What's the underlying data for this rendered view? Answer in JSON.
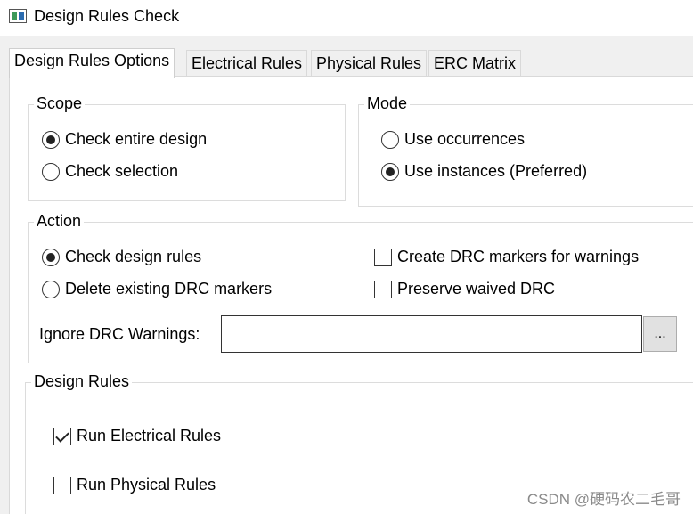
{
  "window": {
    "title": "Design Rules Check",
    "icon": "app-icon"
  },
  "tabs": [
    {
      "label": "Design Rules Options",
      "active": true
    },
    {
      "label": "Electrical Rules",
      "active": false
    },
    {
      "label": "Physical Rules",
      "active": false
    },
    {
      "label": "ERC Matrix",
      "active": false
    }
  ],
  "scope": {
    "label": "Scope",
    "options": [
      {
        "label": "Check entire design",
        "selected": true
      },
      {
        "label": "Check selection",
        "selected": false
      }
    ]
  },
  "mode": {
    "label": "Mode",
    "options": [
      {
        "label": "Use occurrences",
        "selected": false
      },
      {
        "label": "Use instances (Preferred)",
        "selected": true
      }
    ]
  },
  "action": {
    "label": "Action",
    "radios": [
      {
        "label": "Check design rules",
        "selected": true
      },
      {
        "label": "Delete existing DRC markers",
        "selected": false
      }
    ],
    "checks": [
      {
        "label": "Create DRC markers for warnings",
        "checked": false
      },
      {
        "label": "Preserve waived DRC",
        "checked": false
      }
    ],
    "ignore_label": "Ignore DRC Warnings:",
    "ignore_value": "",
    "browse_label": "..."
  },
  "design_rules": {
    "label": "Design Rules",
    "checks": [
      {
        "label": "Run Electrical Rules",
        "checked": true
      },
      {
        "label": "Run Physical Rules",
        "checked": false
      }
    ]
  },
  "watermark": "CSDN @硬码农二毛哥"
}
